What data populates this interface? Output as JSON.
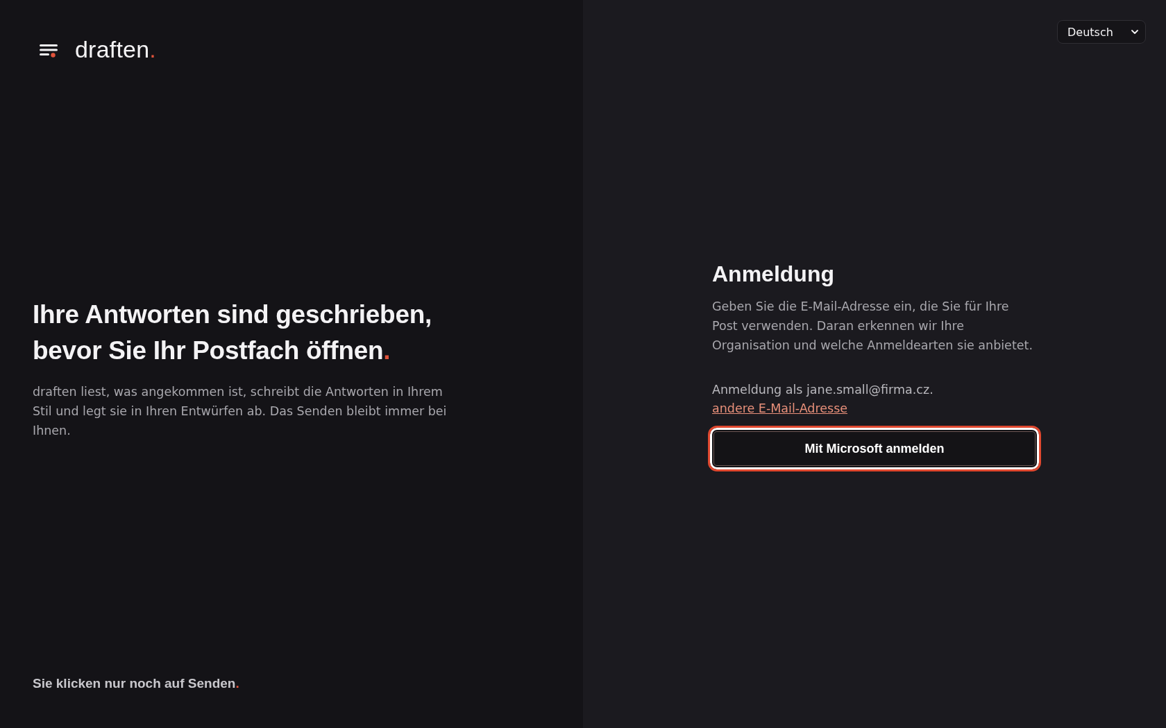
{
  "brand": {
    "name": "draften",
    "accent": "."
  },
  "language_select": {
    "value": "Deutsch"
  },
  "hero": {
    "headline": "Ihre Antworten sind geschrieben, bevor Sie Ihr Postfach öffnen",
    "headline_accent": ".",
    "description": "draften liest, was angekommen ist, schreibt die Antworten in Ihrem Stil und legt sie in Ihren Entwürfen ab. Das Senden bleibt immer bei Ihnen."
  },
  "tagline": {
    "text": "Sie klicken nur noch auf Senden",
    "accent": "."
  },
  "sign_in": {
    "title": "Anmeldung",
    "description": "Geben Sie die E-Mail-Adresse ein, die Sie für Ihre Post verwenden. Daran erkennen wir Ihre Organisation und welche Anmeldearten sie anbietet.",
    "signed_in_as": "Anmeldung als jane.small@firma.cz.",
    "change_email_link": "andere E-Mail-Adresse",
    "button": {
      "label": "Mit Microsoft anmelden",
      "focused": true
    }
  }
}
